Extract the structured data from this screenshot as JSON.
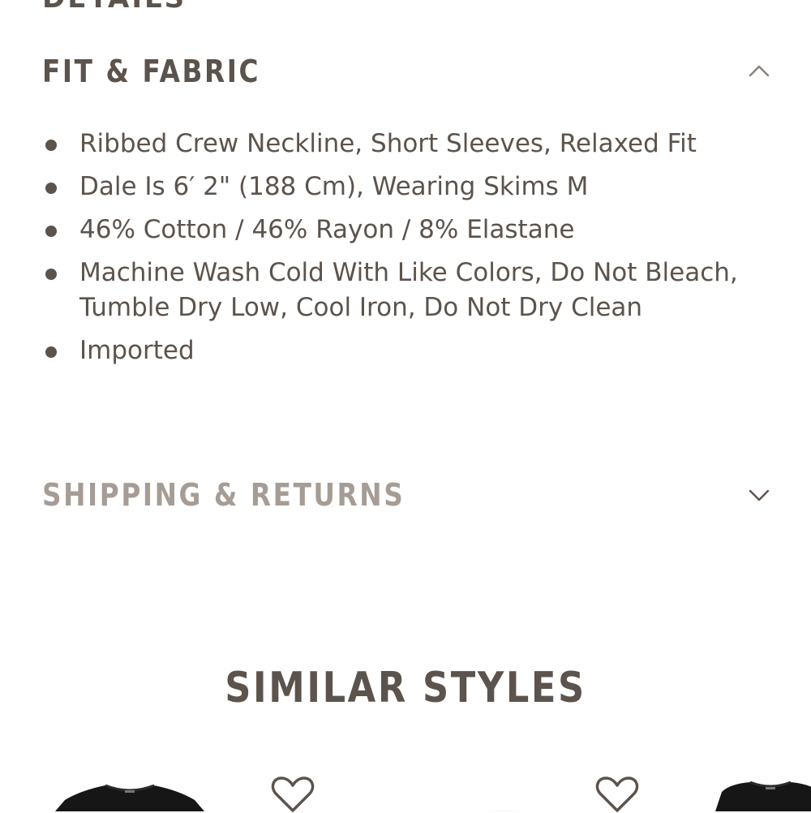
{
  "details_section": {
    "title": "DETAILS"
  },
  "fit_fabric": {
    "title": "FIT & FABRIC",
    "expanded": true,
    "toggle_icon": "chevron-up-icon",
    "bullets": [
      "Ribbed Crew Neckline, Short Sleeves, Relaxed Fit",
      "Dale Is 6′ 2\" (188 Cm), Wearing Skims M",
      "46% Cotton / 46% Rayon / 8% Elastane",
      "Machine Wash Cold With Like Colors, Do Not Bleach, Tumble Dry Low, Cool Iron, Do Not Dry Clean",
      "Imported"
    ]
  },
  "shipping_returns": {
    "title": "SHIPPING & RETURNS",
    "expanded": false,
    "toggle_icon": "chevron-down-icon"
  },
  "similar_styles": {
    "title": "SIMILAR STYLES",
    "products": [
      {
        "image_icon": "black-tshirt-thumbnail",
        "wishlist_icon": "heart-outline-icon"
      },
      {
        "image_icon": "white-tshirt-thumbnail",
        "wishlist_icon": "heart-outline-icon"
      }
    ]
  },
  "colors": {
    "text": "#5c534c",
    "muted": "#a59d95",
    "background": "#ffffff"
  }
}
